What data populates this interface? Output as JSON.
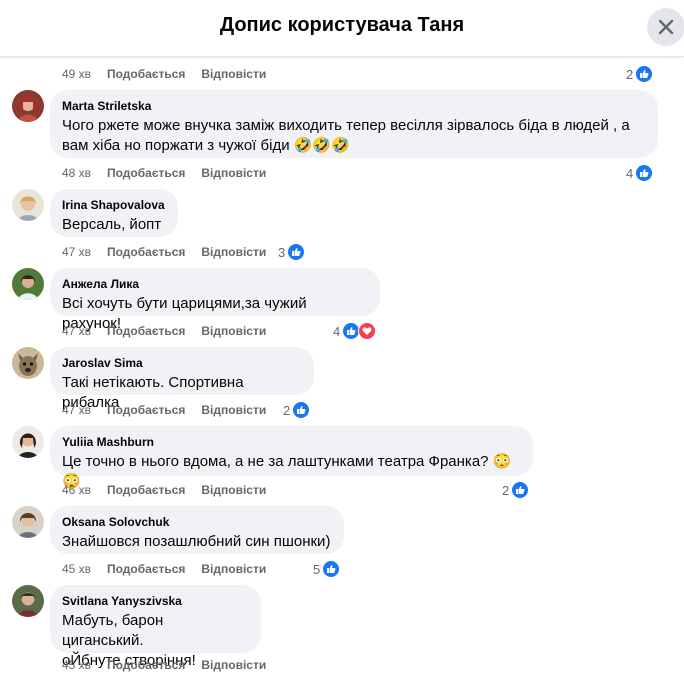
{
  "header": {
    "title": "Допис користувача Таня"
  },
  "actions": {
    "like": "Подобається",
    "reply": "Відповісти"
  },
  "colors": {
    "like_blue": "#1877f2",
    "love_red": "#f33e58",
    "meta_gray": "#65676b",
    "bubble_bg": "#f0f2f5"
  },
  "top_meta": {
    "time": "49 хв",
    "reactions": "2"
  },
  "comments": [
    {
      "author": "Marta Striletska",
      "text": "Чого ржете може внучка заміж виходить тепер весілля зірвалось біда в людей , а вам хіба но поржати з чужої біди 🤣🤣🤣",
      "time": "48 хв",
      "reactions": "4"
    },
    {
      "author": "Irina Shapovalova",
      "text": "Версаль, йопт",
      "time": "47 хв",
      "reactions": "3"
    },
    {
      "author": "Анжела Лика",
      "text": "Всі хочуть бути царицями,за чужий рахунок!",
      "time": "47 хв",
      "reactions": "4"
    },
    {
      "author": "Jaroslav Sima",
      "text": "Такі нетікають. Спортивна рибалка",
      "time": "47 хв",
      "reactions": "2"
    },
    {
      "author": "Yuliia Mashburn",
      "text": "Це точно в нього вдома, а не за лаштунками театра Франка? 😳😳",
      "time": "46 хв",
      "reactions": "2"
    },
    {
      "author": "Oksana Solovchuk",
      "text": "Знайшовся позашлюбний син пшонки)",
      "time": "45 хв",
      "reactions": "5"
    },
    {
      "author": "Svitlana Yanyszivska",
      "text": "Мабуть, барон циганський.\nоЙбнуте створіння!",
      "time": "45 хв",
      "reactions": ""
    }
  ]
}
